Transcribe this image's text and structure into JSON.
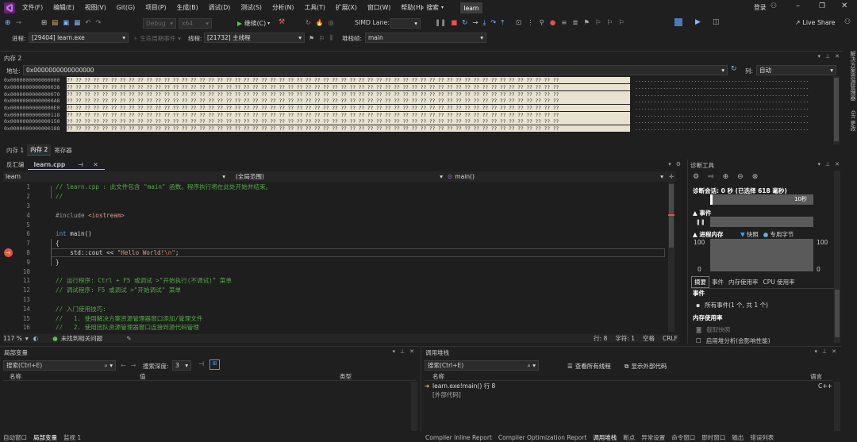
{
  "menu": [
    "文件(F)",
    "编辑(E)",
    "视图(V)",
    "Git(G)",
    "项目(P)",
    "生成(B)",
    "调试(D)",
    "测试(S)",
    "分析(N)",
    "工具(T)",
    "扩展(X)",
    "窗口(W)",
    "帮助(H)"
  ],
  "search_label": "搜索",
  "solution_badge": "learn",
  "login": "登录",
  "live_share": "Live Share",
  "toolbar": {
    "config": "Debug",
    "platform": "x64",
    "continue": "继续(C)",
    "simd": "SIMD Lane:"
  },
  "toolbar2": {
    "process_label": "进程:",
    "process": "[29404] learn.exe",
    "lifecycle": "生命周期事件",
    "thread_label": "线程:",
    "thread": "[21732] 主线程",
    "stack_label": "堆栈帧:",
    "stack": "main"
  },
  "memory": {
    "title": "内存 2",
    "address_label": "地址:",
    "address": "0x0000000000000000",
    "columns_label": "列:",
    "columns": "自动",
    "rows": [
      "0x0000000000000000",
      "0x0000000000000038",
      "0x0000000000000070",
      "0x00000000000000A8",
      "0x00000000000000E0",
      "0x0000000000000118",
      "0x0000000000000150",
      "0x0000000000000188"
    ],
    "hex": "?? ?? ?? ?? ?? ?? ?? ?? ?? ?? ?? ?? ?? ?? ?? ?? ?? ?? ?? ?? ?? ?? ?? ?? ?? ?? ?? ?? ?? ?? ?? ?? ?? ?? ?? ?? ?? ?? ?? ?? ?? ?? ?? ?? ?? ?? ?? ?? ?? ?? ?? ?? ?? ?? ?? ??",
    "ascii": "........................................................",
    "tabs": [
      "内存 1",
      "内存 2",
      "寄存器"
    ]
  },
  "side_panel": [
    "解决方案资源管理器",
    "Git 更改"
  ],
  "editor": {
    "tabs": [
      "反汇编",
      "learn.cpp"
    ],
    "project": "learn",
    "scope": "(全局范围)",
    "func": "main()",
    "lines": [
      {
        "n": "1",
        "parts": [
          {
            "c": "cmt",
            "t": "// learn.cpp : 此文件包含 \"main\" 函数。程序执行将在此处开始并结束。"
          }
        ]
      },
      {
        "n": "2",
        "parts": [
          {
            "c": "cmt",
            "t": "//"
          }
        ]
      },
      {
        "n": "3",
        "parts": []
      },
      {
        "n": "4",
        "parts": [
          {
            "c": "pp",
            "t": "#include "
          },
          {
            "c": "str",
            "t": "<iostream>"
          }
        ]
      },
      {
        "n": "5",
        "parts": []
      },
      {
        "n": "6",
        "parts": [
          {
            "c": "kw",
            "t": "int"
          },
          {
            "c": "plain",
            "t": " main()"
          }
        ]
      },
      {
        "n": "7",
        "parts": [
          {
            "c": "plain",
            "t": "{"
          }
        ]
      },
      {
        "n": "8",
        "parts": [
          {
            "c": "plain",
            "t": "    std::cout << "
          },
          {
            "c": "str",
            "t": "\"Hello World!"
          },
          {
            "c": "esc",
            "t": "\\n"
          },
          {
            "c": "str",
            "t": "\""
          },
          {
            "c": "plain",
            "t": ";"
          }
        ]
      },
      {
        "n": "9",
        "parts": [
          {
            "c": "plain",
            "t": "}"
          }
        ]
      },
      {
        "n": "10",
        "parts": []
      },
      {
        "n": "11",
        "parts": [
          {
            "c": "cmt",
            "t": "// 运行程序: Ctrl + F5 或调试 >\"开始执行(不调试)\" 菜单"
          }
        ]
      },
      {
        "n": "12",
        "parts": [
          {
            "c": "cmt",
            "t": "// 调试程序: F5 或调试 >\"开始调试\" 菜单"
          }
        ]
      },
      {
        "n": "13",
        "parts": []
      },
      {
        "n": "14",
        "parts": [
          {
            "c": "cmt",
            "t": "// 入门使用技巧:"
          }
        ]
      },
      {
        "n": "15",
        "parts": [
          {
            "c": "cmt",
            "t": "//   1. 使用解决方案资源管理器窗口添加/管理文件"
          }
        ]
      },
      {
        "n": "16",
        "parts": [
          {
            "c": "cmt",
            "t": "//   2. 使用团队资源管理器窗口连接到源代码管理"
          }
        ]
      }
    ],
    "status": {
      "zoom": "117 %",
      "issues": "未找到相关问题",
      "line": "行: 8",
      "char": "字符: 1",
      "spaces": "空格",
      "eol": "CRLF"
    }
  },
  "diag": {
    "title": "诊断工具",
    "session": "诊断会话: 0 秒 (已选择 618 毫秒)",
    "tick": "10秒",
    "events_section": "事件",
    "process_mem": "进程内存",
    "snapshot": "快照",
    "private_bytes": "专用字节",
    "y_top": "100",
    "y_bottom": "0",
    "tabs": [
      "摘要",
      "事件",
      "内存使用率",
      "CPU 使用率"
    ],
    "events_label": "事件",
    "all_events": "所有事件(1 个, 共 1 个)",
    "memory_usage": "内存使用率",
    "take_snapshot": "截取快照",
    "enable_heap": "启用堆分析(会影响性能)"
  },
  "locals": {
    "title": "局部变量",
    "search": "搜索(Ctrl+E)",
    "depth_label": "搜索深度:",
    "depth": "3",
    "cols": [
      "名称",
      "值",
      "类型"
    ],
    "tabs": [
      "自动窗口",
      "局部变量",
      "监视 1"
    ]
  },
  "callstack": {
    "title": "调用堆栈",
    "search": "搜索(Ctrl+E)",
    "view_threads": "查看所有线程",
    "show_external": "显示外部代码",
    "cols": [
      "名称",
      "语言"
    ],
    "rows": [
      {
        "name": "learn.exe!main() 行 8",
        "lang": "C++"
      },
      {
        "name": "[外部代码]",
        "lang": ""
      }
    ],
    "tabs": [
      "Compiler Inline Report",
      "Compiler Optimization Report",
      "调用堆栈",
      "断点",
      "异常设置",
      "命令窗口",
      "即时窗口",
      "输出",
      "错误列表"
    ]
  }
}
